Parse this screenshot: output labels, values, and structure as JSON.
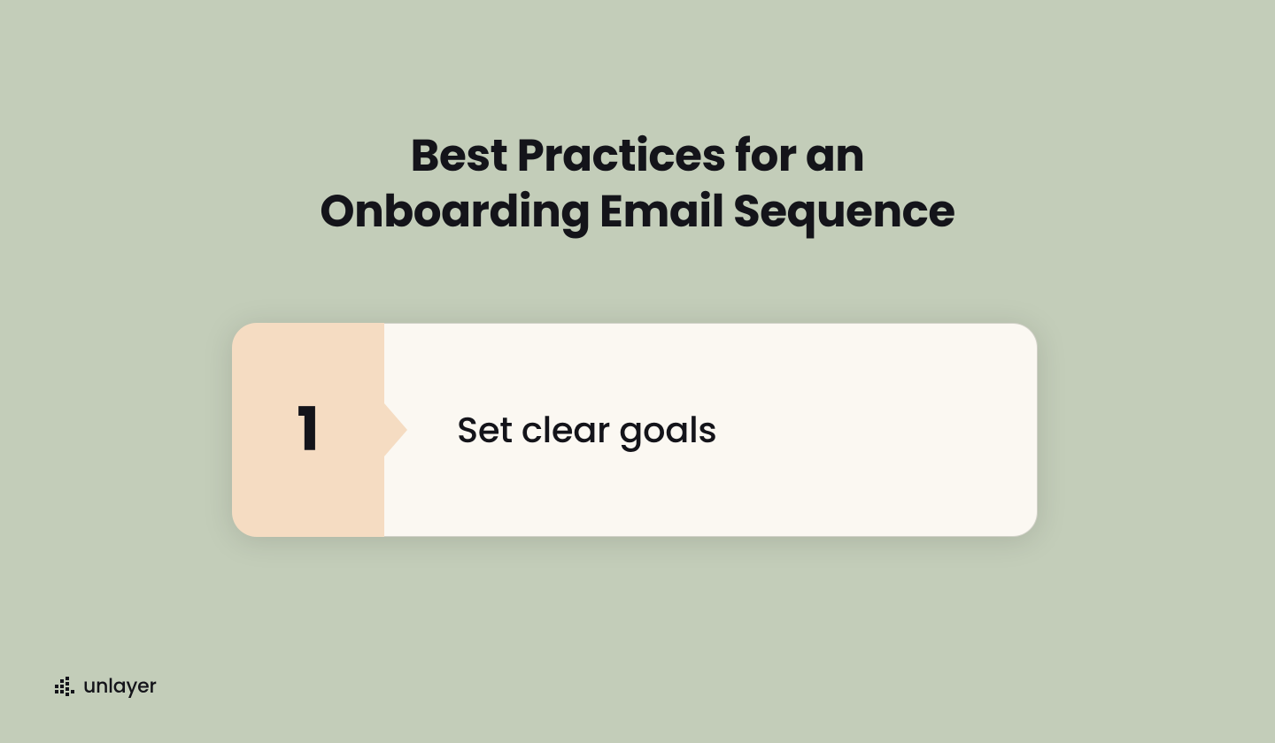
{
  "heading": {
    "line1": "Best Practices for an",
    "line2": "Onboarding Email Sequence"
  },
  "card": {
    "number": "1",
    "text": "Set clear goals"
  },
  "brand": {
    "name": "unlayer"
  },
  "colors": {
    "background": "#c3cdb9",
    "cardAccent": "#f5dcc2",
    "cardBody": "#fbf8f2",
    "text": "#14141a"
  }
}
